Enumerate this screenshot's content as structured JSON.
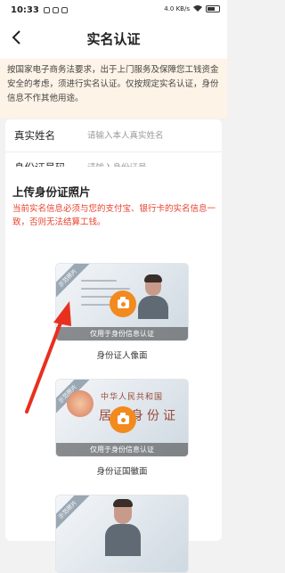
{
  "status_bar": {
    "time": "10:33",
    "net_speed": "4.0 KB/s",
    "battery_icon": "battery-icon"
  },
  "header": {
    "title": "实名认证",
    "back_icon": "chevron-left-icon"
  },
  "notice": {
    "text": "按国家电子商务法要求，出于上门服务及保障您工钱资金安全的考虑，须进行实名认证。仅按规定实名认证，身份信息不作其他用途。"
  },
  "form": {
    "name_label": "真实姓名",
    "name_placeholder": "请输入本人真实姓名",
    "id_label": "身份证号码",
    "id_placeholder": "请输入身份证号"
  },
  "upload": {
    "title": "上传身份证照片",
    "warning": "当前实名信息必须与您的支付宝、银行卡的实名信息一致，否则无法结算工钱。",
    "ribbon_text": "示范照片",
    "band_text": "仅用于身份信息认证",
    "cards": [
      {
        "caption": "身份证人像面"
      },
      {
        "caption": "身份证国徽面",
        "emblem_line1": "中华人民共和国",
        "emblem_line2": "居民身份证"
      },
      {
        "caption": ""
      }
    ]
  },
  "colors": {
    "accent": "#f28a1e",
    "warning": "#e8412c",
    "notice_bg": "#fdf3e7",
    "annotation_arrow": "#e8301f"
  }
}
